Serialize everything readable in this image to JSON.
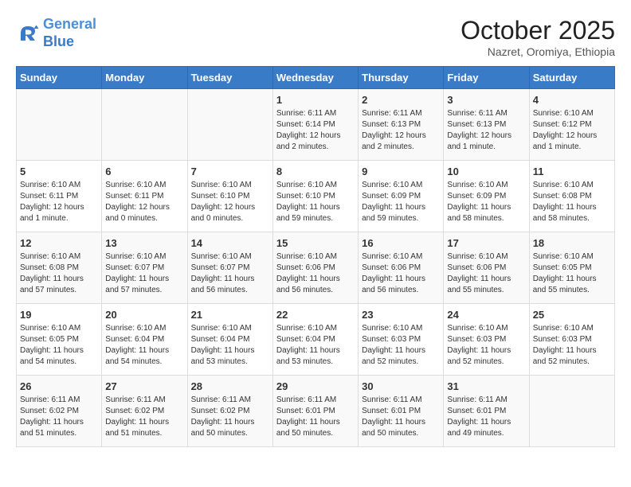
{
  "header": {
    "logo": {
      "line1": "General",
      "line2": "Blue"
    },
    "month": "October 2025",
    "location": "Nazret, Oromiya, Ethiopia"
  },
  "weekdays": [
    "Sunday",
    "Monday",
    "Tuesday",
    "Wednesday",
    "Thursday",
    "Friday",
    "Saturday"
  ],
  "weeks": [
    [
      {
        "day": "",
        "info": ""
      },
      {
        "day": "",
        "info": ""
      },
      {
        "day": "",
        "info": ""
      },
      {
        "day": "1",
        "info": "Sunrise: 6:11 AM\nSunset: 6:14 PM\nDaylight: 12 hours and 2 minutes."
      },
      {
        "day": "2",
        "info": "Sunrise: 6:11 AM\nSunset: 6:13 PM\nDaylight: 12 hours and 2 minutes."
      },
      {
        "day": "3",
        "info": "Sunrise: 6:11 AM\nSunset: 6:13 PM\nDaylight: 12 hours and 1 minute."
      },
      {
        "day": "4",
        "info": "Sunrise: 6:10 AM\nSunset: 6:12 PM\nDaylight: 12 hours and 1 minute."
      }
    ],
    [
      {
        "day": "5",
        "info": "Sunrise: 6:10 AM\nSunset: 6:11 PM\nDaylight: 12 hours and 1 minute."
      },
      {
        "day": "6",
        "info": "Sunrise: 6:10 AM\nSunset: 6:11 PM\nDaylight: 12 hours and 0 minutes."
      },
      {
        "day": "7",
        "info": "Sunrise: 6:10 AM\nSunset: 6:10 PM\nDaylight: 12 hours and 0 minutes."
      },
      {
        "day": "8",
        "info": "Sunrise: 6:10 AM\nSunset: 6:10 PM\nDaylight: 11 hours and 59 minutes."
      },
      {
        "day": "9",
        "info": "Sunrise: 6:10 AM\nSunset: 6:09 PM\nDaylight: 11 hours and 59 minutes."
      },
      {
        "day": "10",
        "info": "Sunrise: 6:10 AM\nSunset: 6:09 PM\nDaylight: 11 hours and 58 minutes."
      },
      {
        "day": "11",
        "info": "Sunrise: 6:10 AM\nSunset: 6:08 PM\nDaylight: 11 hours and 58 minutes."
      }
    ],
    [
      {
        "day": "12",
        "info": "Sunrise: 6:10 AM\nSunset: 6:08 PM\nDaylight: 11 hours and 57 minutes."
      },
      {
        "day": "13",
        "info": "Sunrise: 6:10 AM\nSunset: 6:07 PM\nDaylight: 11 hours and 57 minutes."
      },
      {
        "day": "14",
        "info": "Sunrise: 6:10 AM\nSunset: 6:07 PM\nDaylight: 11 hours and 56 minutes."
      },
      {
        "day": "15",
        "info": "Sunrise: 6:10 AM\nSunset: 6:06 PM\nDaylight: 11 hours and 56 minutes."
      },
      {
        "day": "16",
        "info": "Sunrise: 6:10 AM\nSunset: 6:06 PM\nDaylight: 11 hours and 56 minutes."
      },
      {
        "day": "17",
        "info": "Sunrise: 6:10 AM\nSunset: 6:06 PM\nDaylight: 11 hours and 55 minutes."
      },
      {
        "day": "18",
        "info": "Sunrise: 6:10 AM\nSunset: 6:05 PM\nDaylight: 11 hours and 55 minutes."
      }
    ],
    [
      {
        "day": "19",
        "info": "Sunrise: 6:10 AM\nSunset: 6:05 PM\nDaylight: 11 hours and 54 minutes."
      },
      {
        "day": "20",
        "info": "Sunrise: 6:10 AM\nSunset: 6:04 PM\nDaylight: 11 hours and 54 minutes."
      },
      {
        "day": "21",
        "info": "Sunrise: 6:10 AM\nSunset: 6:04 PM\nDaylight: 11 hours and 53 minutes."
      },
      {
        "day": "22",
        "info": "Sunrise: 6:10 AM\nSunset: 6:04 PM\nDaylight: 11 hours and 53 minutes."
      },
      {
        "day": "23",
        "info": "Sunrise: 6:10 AM\nSunset: 6:03 PM\nDaylight: 11 hours and 52 minutes."
      },
      {
        "day": "24",
        "info": "Sunrise: 6:10 AM\nSunset: 6:03 PM\nDaylight: 11 hours and 52 minutes."
      },
      {
        "day": "25",
        "info": "Sunrise: 6:10 AM\nSunset: 6:03 PM\nDaylight: 11 hours and 52 minutes."
      }
    ],
    [
      {
        "day": "26",
        "info": "Sunrise: 6:11 AM\nSunset: 6:02 PM\nDaylight: 11 hours and 51 minutes."
      },
      {
        "day": "27",
        "info": "Sunrise: 6:11 AM\nSunset: 6:02 PM\nDaylight: 11 hours and 51 minutes."
      },
      {
        "day": "28",
        "info": "Sunrise: 6:11 AM\nSunset: 6:02 PM\nDaylight: 11 hours and 50 minutes."
      },
      {
        "day": "29",
        "info": "Sunrise: 6:11 AM\nSunset: 6:01 PM\nDaylight: 11 hours and 50 minutes."
      },
      {
        "day": "30",
        "info": "Sunrise: 6:11 AM\nSunset: 6:01 PM\nDaylight: 11 hours and 50 minutes."
      },
      {
        "day": "31",
        "info": "Sunrise: 6:11 AM\nSunset: 6:01 PM\nDaylight: 11 hours and 49 minutes."
      },
      {
        "day": "",
        "info": ""
      }
    ]
  ]
}
